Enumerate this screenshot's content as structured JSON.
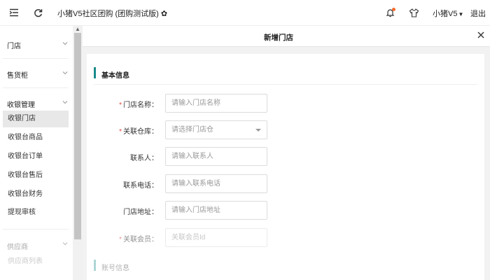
{
  "header": {
    "title": "小猪V5社区团购 (团购测试版)",
    "gear_icon": "gear-icon",
    "user_name": "小猪V5",
    "logout_label": "退出"
  },
  "sidebar": {
    "groups": [
      {
        "label": "门店"
      },
      {
        "label": "售货柜"
      },
      {
        "label": "收银管理"
      },
      {
        "label": "供应商"
      }
    ],
    "items": [
      {
        "label": "收银门店"
      },
      {
        "label": "收银台商品"
      },
      {
        "label": "收银台订单"
      },
      {
        "label": "收银台售后"
      },
      {
        "label": "收银台财务"
      },
      {
        "label": "提现审核"
      },
      {
        "label": "供应商列表"
      }
    ],
    "active_item": "收银门店"
  },
  "dialog": {
    "title": "新增门店",
    "section_basic": "基本信息",
    "section_account": "账号信息",
    "fields": [
      {
        "label": "门店名称：",
        "required": "*",
        "placeholder": "请输入门店名称"
      },
      {
        "label": "关联仓库：",
        "required": "*",
        "placeholder": "请选择门店仓"
      },
      {
        "label": "联系人：",
        "required": "",
        "placeholder": "请输入联系人"
      },
      {
        "label": "联系电话：",
        "required": "",
        "placeholder": "请输入联系电话"
      },
      {
        "label": "门店地址：",
        "required": "",
        "placeholder": "请输入门店地址"
      },
      {
        "label": "关联会员：",
        "required": "*",
        "placeholder": "关联会员Id"
      }
    ]
  },
  "colors": {
    "accent": "#1a8a8a",
    "required": "#e0453d",
    "notification_dot": "#f56c2d"
  }
}
